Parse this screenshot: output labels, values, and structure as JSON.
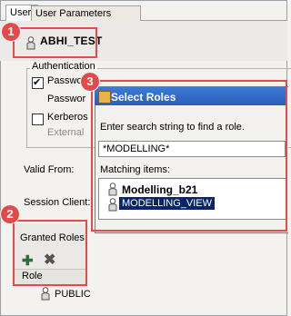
{
  "tabs": [
    {
      "label": "User"
    },
    {
      "label": "User Parameters"
    }
  ],
  "user": {
    "name": "ABHI_TEST"
  },
  "authentication": {
    "group_label": "Authentication",
    "password_label": "Passwor",
    "password_sub_label": "Passwor",
    "kerberos_label": "Kerberos",
    "external_label": "External"
  },
  "form": {
    "valid_from_label": "Valid From:",
    "session_client_label": "Session Client:"
  },
  "granted_roles": {
    "title": "Granted Roles",
    "column_role": "Role",
    "rows": [
      "PUBLIC"
    ]
  },
  "dialog": {
    "title": "Select Roles",
    "hint": "Enter search string to find a role.",
    "search_value": "*MODELLING*",
    "matching_label": "Matching items:",
    "items": [
      {
        "label": "Modelling_b21"
      },
      {
        "label": "MODELLING_VIEW"
      }
    ]
  },
  "callouts": [
    "1",
    "2",
    "3"
  ],
  "colors": {
    "callout": "#e44a4a",
    "titlebar": "#2a5fb8",
    "selection": "#0a246a"
  }
}
